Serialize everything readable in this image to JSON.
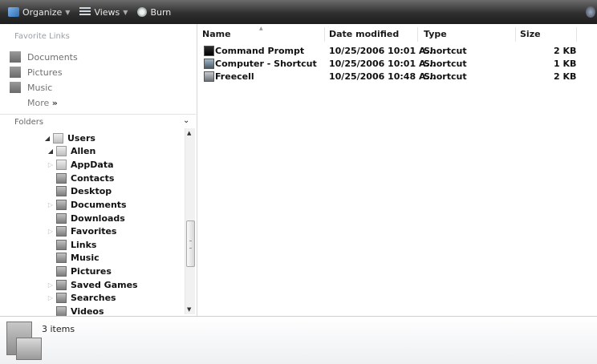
{
  "toolbar": {
    "organize_label": "Organize",
    "views_label": "Views",
    "burn_label": "Burn"
  },
  "nav": {
    "favorites_header": "Favorite Links",
    "favorites": [
      {
        "label": "Documents",
        "icon": "documents-icon"
      },
      {
        "label": "Pictures",
        "icon": "pictures-icon"
      },
      {
        "label": "Music",
        "icon": "music-icon"
      }
    ],
    "more_label": "More",
    "folders_label": "Folders",
    "tree": [
      {
        "label": "Users",
        "level": 1,
        "expanded": true
      },
      {
        "label": "Allen",
        "level": 2,
        "expanded": true
      },
      {
        "label": "AppData",
        "level": 3,
        "expandable": true
      },
      {
        "label": "Contacts",
        "level": 3,
        "expandable": false
      },
      {
        "label": "Desktop",
        "level": 3,
        "expandable": false
      },
      {
        "label": "Documents",
        "level": 3,
        "expandable": true
      },
      {
        "label": "Downloads",
        "level": 3,
        "expandable": false
      },
      {
        "label": "Favorites",
        "level": 3,
        "expandable": true
      },
      {
        "label": "Links",
        "level": 3,
        "expandable": false
      },
      {
        "label": "Music",
        "level": 3,
        "expandable": false
      },
      {
        "label": "Pictures",
        "level": 3,
        "expandable": false
      },
      {
        "label": "Saved Games",
        "level": 3,
        "expandable": true
      },
      {
        "label": "Searches",
        "level": 3,
        "expandable": true
      },
      {
        "label": "Videos",
        "level": 3,
        "expandable": false
      }
    ]
  },
  "filelist": {
    "columns": [
      "Name",
      "Date modified",
      "Type",
      "Size"
    ],
    "rows": [
      {
        "name": "Command Prompt",
        "date": "10/25/2006 10:01 A...",
        "type": "Shortcut",
        "size": "2 KB"
      },
      {
        "name": "Computer - Shortcut",
        "date": "10/25/2006 10:01 A...",
        "type": "Shortcut",
        "size": "1 KB"
      },
      {
        "name": "Freecell",
        "date": "10/25/2006 10:48 A...",
        "type": "Shortcut",
        "size": "2 KB"
      }
    ]
  },
  "details": {
    "item_count": "3 items"
  }
}
